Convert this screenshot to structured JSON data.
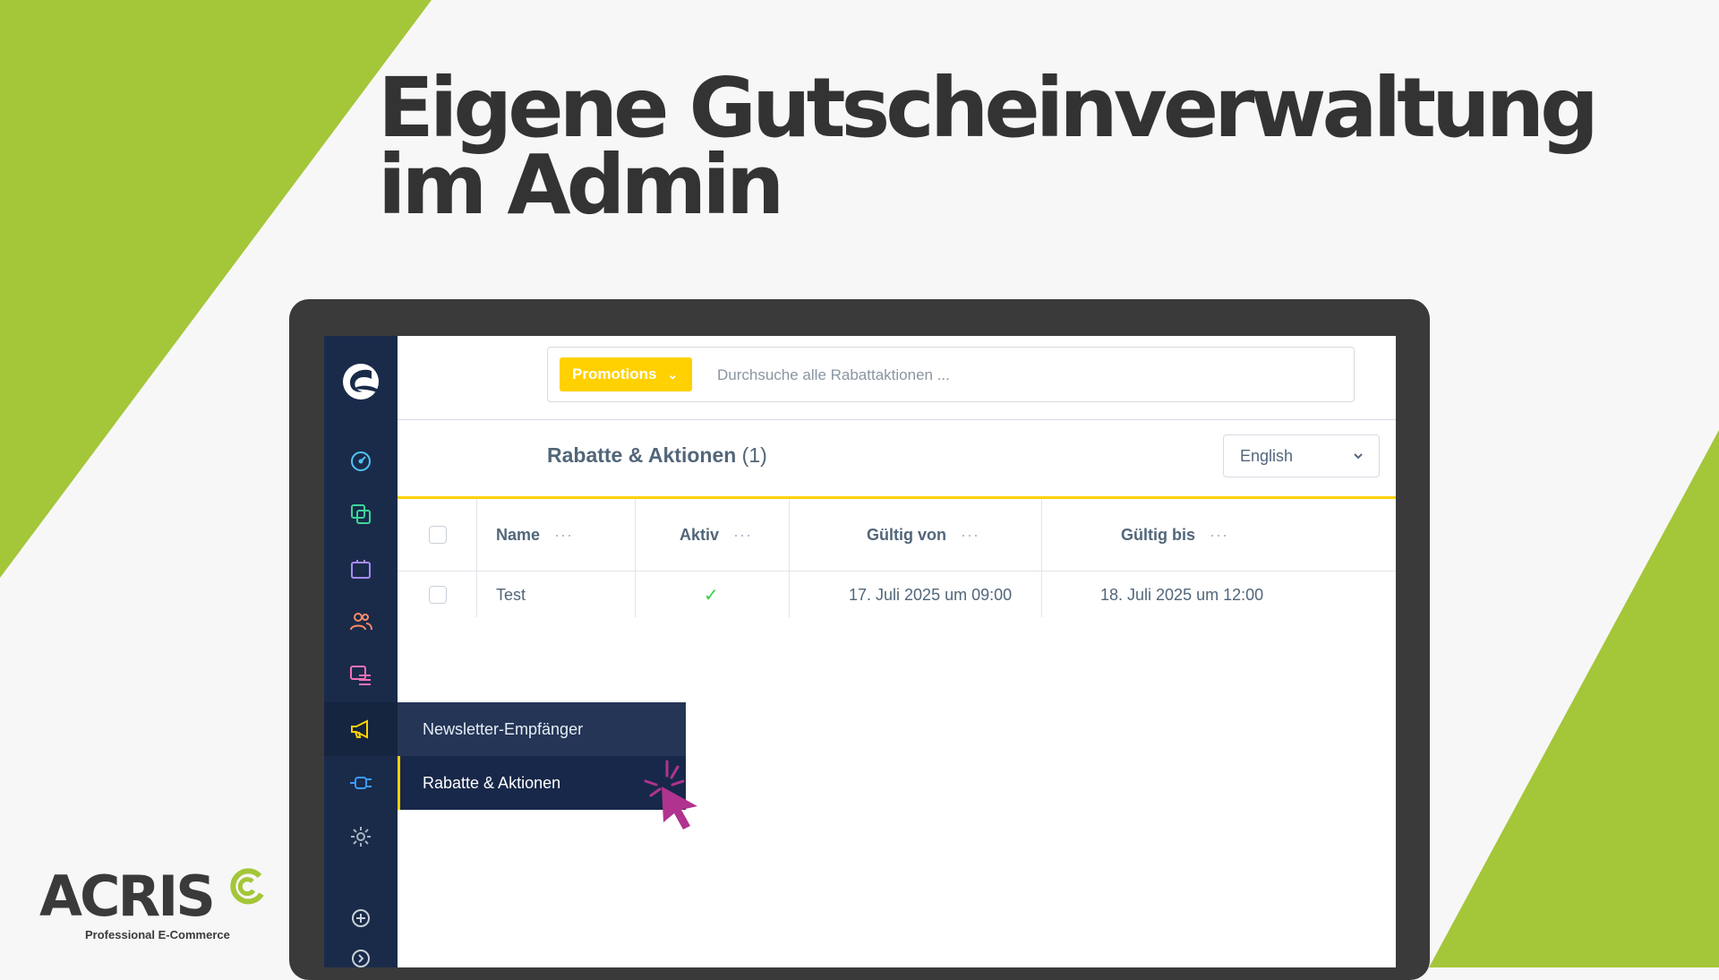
{
  "headline": "Eigene Gutscheinverwaltung im Admin",
  "colors": {
    "accent_green": "#a4c639",
    "accent_yellow": "#ffd100",
    "sidebar_navy": "#1a2b4a",
    "text_dark": "#333333",
    "cursor_magenta": "#b0338f"
  },
  "sidebar": {
    "logo_icon": "shopware-logo-icon",
    "items": [
      {
        "icon": "dashboard-icon",
        "color": "#4fc3f7"
      },
      {
        "icon": "catalog-icon",
        "color": "#3dd598"
      },
      {
        "icon": "orders-icon",
        "color": "#a78bfa"
      },
      {
        "icon": "customers-icon",
        "color": "#ff8a65"
      },
      {
        "icon": "content-icon",
        "color": "#f472b6"
      },
      {
        "icon": "marketing-icon",
        "color": "#ffd100"
      },
      {
        "icon": "extensions-icon",
        "color": "#3b9cff"
      },
      {
        "icon": "settings-icon",
        "color": "#a9b4c0"
      },
      {
        "icon": "add-icon",
        "color": "#c9d0d8"
      },
      {
        "icon": "expand-icon",
        "color": "#c9d0d8"
      }
    ]
  },
  "search": {
    "module_label": "Promotions",
    "placeholder": "Durchsuche alle Rabattaktionen ..."
  },
  "header": {
    "title": "Rabatte & Aktionen",
    "count": "(1)",
    "language": "English"
  },
  "table": {
    "columns": [
      "Name",
      "Aktiv",
      "Gültig von",
      "Gültig bis"
    ],
    "rows": [
      {
        "name": "Test",
        "active": "✓",
        "valid_from": "17. Juli 2025 um 09:00",
        "valid_to": "18. Juli 2025 um 12:00"
      }
    ]
  },
  "flyout": {
    "items": [
      "Newsletter-Empfänger",
      "Rabatte & Aktionen"
    ]
  },
  "brand": {
    "name": "ACRIS",
    "tagline": "Professional E-Commerce"
  }
}
